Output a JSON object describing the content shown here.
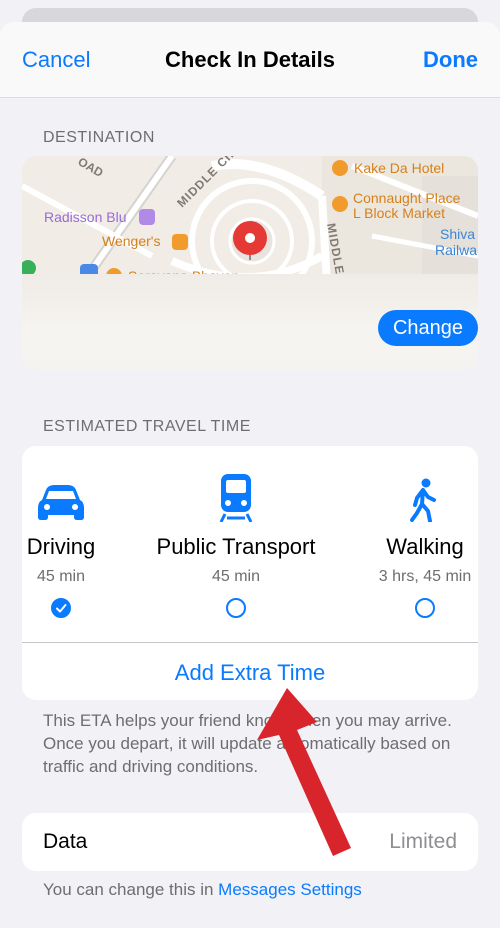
{
  "nav": {
    "cancel": "Cancel",
    "title": "Check In Details",
    "done": "Done"
  },
  "destination": {
    "header": "DESTINATION",
    "change": "Change",
    "map_labels": [
      "OAD",
      "MIDDLE CIRCLE",
      "MIDDLE CI",
      "Kake Da Hotel",
      "Connaught Place",
      "L Block Market",
      "Radisson Blu",
      "Wenger's",
      "Saravana Bhavan",
      "Shiva",
      "Railwa"
    ]
  },
  "travel": {
    "header": "ESTIMATED TRAVEL TIME",
    "modes": [
      {
        "label": "Driving",
        "time": "45 min",
        "icon": "car-icon",
        "selected": true
      },
      {
        "label": "Public Transport",
        "time": "45 min",
        "icon": "train-icon",
        "selected": false
      },
      {
        "label": "Walking",
        "time": "3 hrs, 45 min",
        "icon": "walk-icon",
        "selected": false
      }
    ],
    "add_extra": "Add Extra Time",
    "note": "This ETA helps your friend know when you may arrive. Once you depart, it will update automatically based on traffic and driving conditions."
  },
  "data_row": {
    "label": "Data",
    "value": "Limited"
  },
  "footer": {
    "prefix": "You can change this in ",
    "link": "Messages Settings"
  },
  "colors": {
    "accent": "#0a7aff",
    "annotation_arrow": "#d8252c"
  }
}
